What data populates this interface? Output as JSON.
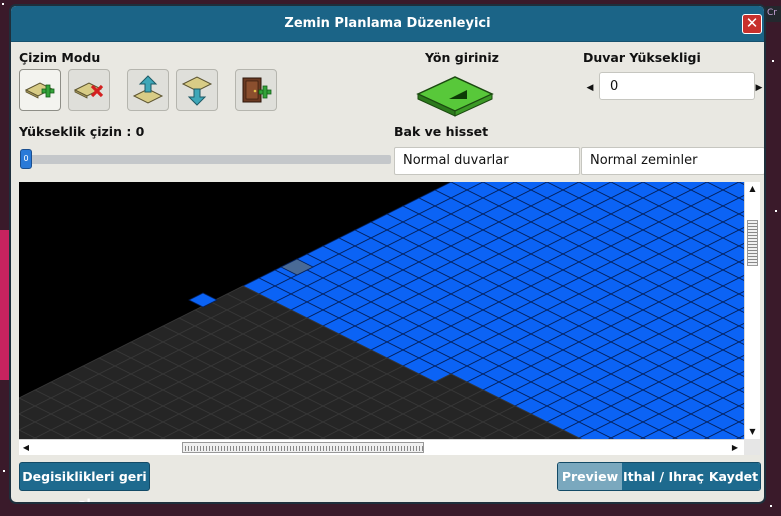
{
  "window": {
    "title": "Zemin Planlama Düzenleyici",
    "close_glyph": "✕"
  },
  "draw_mode": {
    "label": "Çizim Modu",
    "tools": [
      {
        "name": "add-tile-tool",
        "icon": "tile-plus-icon"
      },
      {
        "name": "remove-tile-tool",
        "icon": "tile-x-icon"
      },
      {
        "name": "raise-tile-tool",
        "icon": "tile-up-arrow-icon"
      },
      {
        "name": "lower-tile-tool",
        "icon": "tile-down-arrow-icon"
      },
      {
        "name": "door-tool",
        "icon": "door-plus-icon"
      }
    ]
  },
  "direction": {
    "label": "Yön giriniz",
    "icon": "green-tile-direction-icon"
  },
  "wall_height": {
    "label": "Duvar Yüksekligi",
    "value": "0",
    "left_arrow": "◀",
    "right_arrow": "▶"
  },
  "height_draw": {
    "label": "Yükseklik çizin : 0",
    "slider_value": 0,
    "thumb_label": "0"
  },
  "look_feel": {
    "label": "Bak ve hisset",
    "wall_select": "Normal duvarlar",
    "floor_select": "Normal zeminler"
  },
  "canvas": {
    "colors": {
      "floor": "#0b63f5",
      "floor_line": "#04205a",
      "void": "#252525",
      "void_line": "#383838",
      "selected": "#496a96",
      "background": "#000000"
    }
  },
  "scrollbars": {
    "up": "▲",
    "down": "▼",
    "left": "◀",
    "right": "▶"
  },
  "footer": {
    "undo_label": "Degisiklikleri geri al",
    "preview_label": "Preview",
    "import_export_label": "Ithal / Ihraç",
    "save_label": "Kaydet"
  },
  "corner_badge": "Cr"
}
